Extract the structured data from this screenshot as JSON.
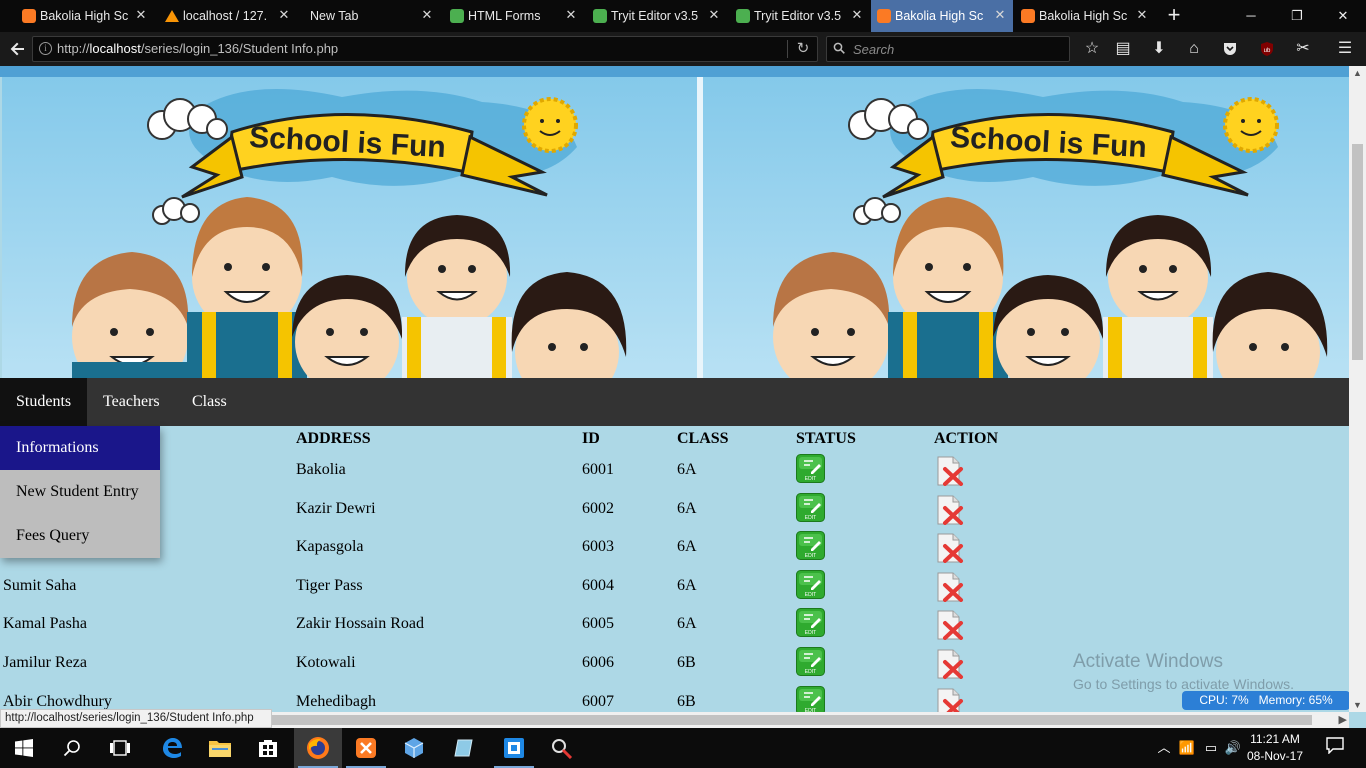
{
  "browser": {
    "tabs": [
      {
        "label": "Bakolia High Sc",
        "icon": "xampp-icon",
        "active": false
      },
      {
        "label": "localhost / 127.",
        "icon": "phpmyadmin-icon",
        "active": false
      },
      {
        "label": "New Tab",
        "icon": "",
        "active": false
      },
      {
        "label": "HTML Forms",
        "icon": "w3schools-icon",
        "active": false
      },
      {
        "label": "Tryit Editor v3.5",
        "icon": "w3schools-icon",
        "active": false
      },
      {
        "label": "Tryit Editor v3.5",
        "icon": "w3schools-icon",
        "active": false
      },
      {
        "label": "Bakolia High Sc",
        "icon": "xampp-icon",
        "active": true
      },
      {
        "label": "Bakolia High Sc",
        "icon": "xampp-icon",
        "active": false
      }
    ],
    "url_prefix": "http://",
    "url_host": "localhost",
    "url_path": "/series/login_136/Student Info.php",
    "search_placeholder": "Search",
    "status_url": "http://localhost/series/login_136/Student Info.php"
  },
  "banner": {
    "text": "School is Fun"
  },
  "menu": {
    "items": [
      "Students",
      "Teachers",
      "Class"
    ],
    "dropdown": [
      "Informations",
      "New Student Entry",
      "Fees Query"
    ]
  },
  "table": {
    "headers": {
      "address": "ADDRESS",
      "id": "ID",
      "class": "CLASS",
      "status": "STATUS",
      "action": "ACTION"
    },
    "rows": [
      {
        "name": "",
        "address": "Bakolia",
        "id": "6001",
        "class": "6A"
      },
      {
        "name": "",
        "address": "Kazir Dewri",
        "id": "6002",
        "class": "6A"
      },
      {
        "name": "",
        "address": "Kapasgola",
        "id": "6003",
        "class": "6A"
      },
      {
        "name": "Sumit Saha",
        "address": "Tiger Pass",
        "id": "6004",
        "class": "6A"
      },
      {
        "name": "Kamal Pasha",
        "address": "Zakir Hossain Road",
        "id": "6005",
        "class": "6A"
      },
      {
        "name": "Jamilur Reza",
        "address": "Kotowali",
        "id": "6006",
        "class": "6B"
      },
      {
        "name": "Abir Chowdhury",
        "address": "Mehedibagh",
        "id": "6007",
        "class": "6B"
      }
    ],
    "edit_icon_label": "EDIT"
  },
  "watermark": {
    "line1": "Activate Windows",
    "line2": "Go to Settings to activate Windows."
  },
  "widget": {
    "text": "CPU: 7%   Memory: 65%"
  },
  "taskbar": {
    "time": "11:21 AM",
    "date": "08-Nov-17",
    "apps": [
      "start-icon",
      "search-icon",
      "task-view-icon",
      "edge-icon",
      "file-explorer-icon",
      "store-icon",
      "firefox-icon",
      "xampp-icon",
      "app-cube-icon",
      "app-glass-icon",
      "app-window-icon",
      "app-tool-icon"
    ]
  },
  "colors": {
    "page_bg": "#add8e6",
    "menu_bg": "#333333",
    "dropdown_active": "#1a168a",
    "tab_active": "#4a6fa5"
  }
}
